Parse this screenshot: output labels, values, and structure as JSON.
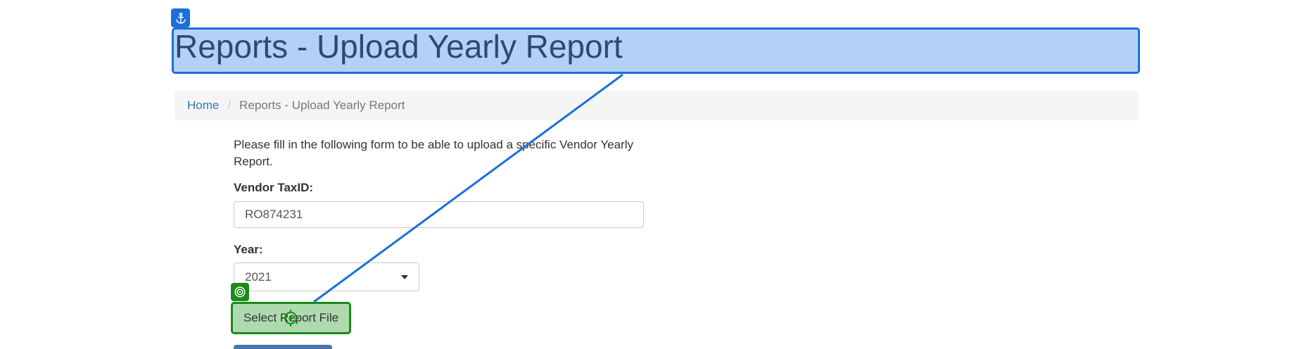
{
  "header": {
    "title": "Reports - Upload Yearly Report"
  },
  "breadcrumb": {
    "home": "Home",
    "separator": "/",
    "current": "Reports - Upload Yearly Report"
  },
  "form": {
    "intro": "Please fill in the following form to be able to upload a specific Vendor Yearly Report.",
    "vendor_label": "Vendor TaxID:",
    "vendor_value": "RO874231",
    "year_label": "Year:",
    "year_selected": "2021",
    "select_file_label": "Select Report File"
  },
  "overlay": {
    "anchor_icon": "anchor-icon",
    "target_icon": "target-icon",
    "crosshair_icon": "crosshair-icon",
    "anchor_color": "#1a6fd9",
    "target_color": "#1a8a1a"
  }
}
